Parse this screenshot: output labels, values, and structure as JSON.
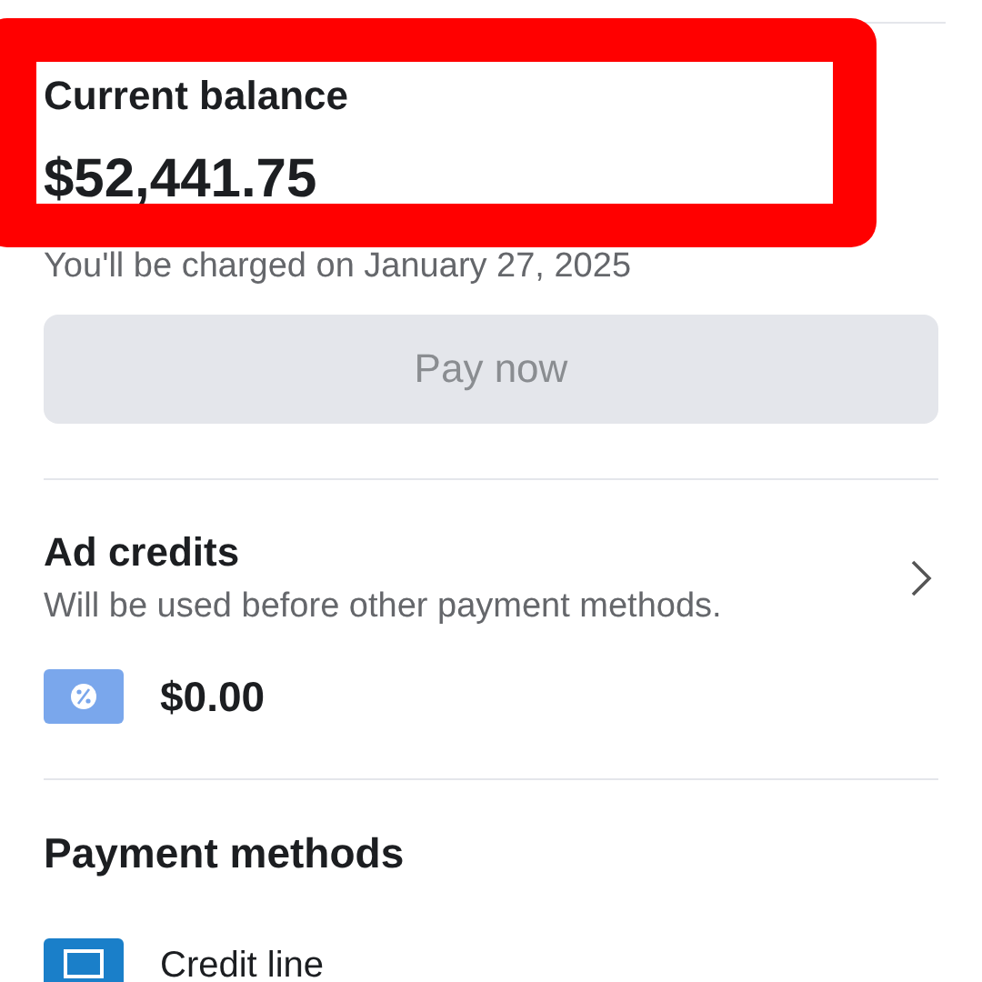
{
  "balance": {
    "label": "Current balance",
    "amount": "$52,441.75",
    "note": "You'll be charged on January 27, 2025"
  },
  "annotation": {
    "kind": "frame"
  },
  "pay_button": {
    "label": "Pay now",
    "disabled": true
  },
  "ad_credits": {
    "title": "Ad credits",
    "subtitle": "Will be used before other payment methods.",
    "amount": "$0.00"
  },
  "payment_methods": {
    "title": "Payment methods",
    "items": [
      {
        "label": "Credit line"
      }
    ]
  }
}
